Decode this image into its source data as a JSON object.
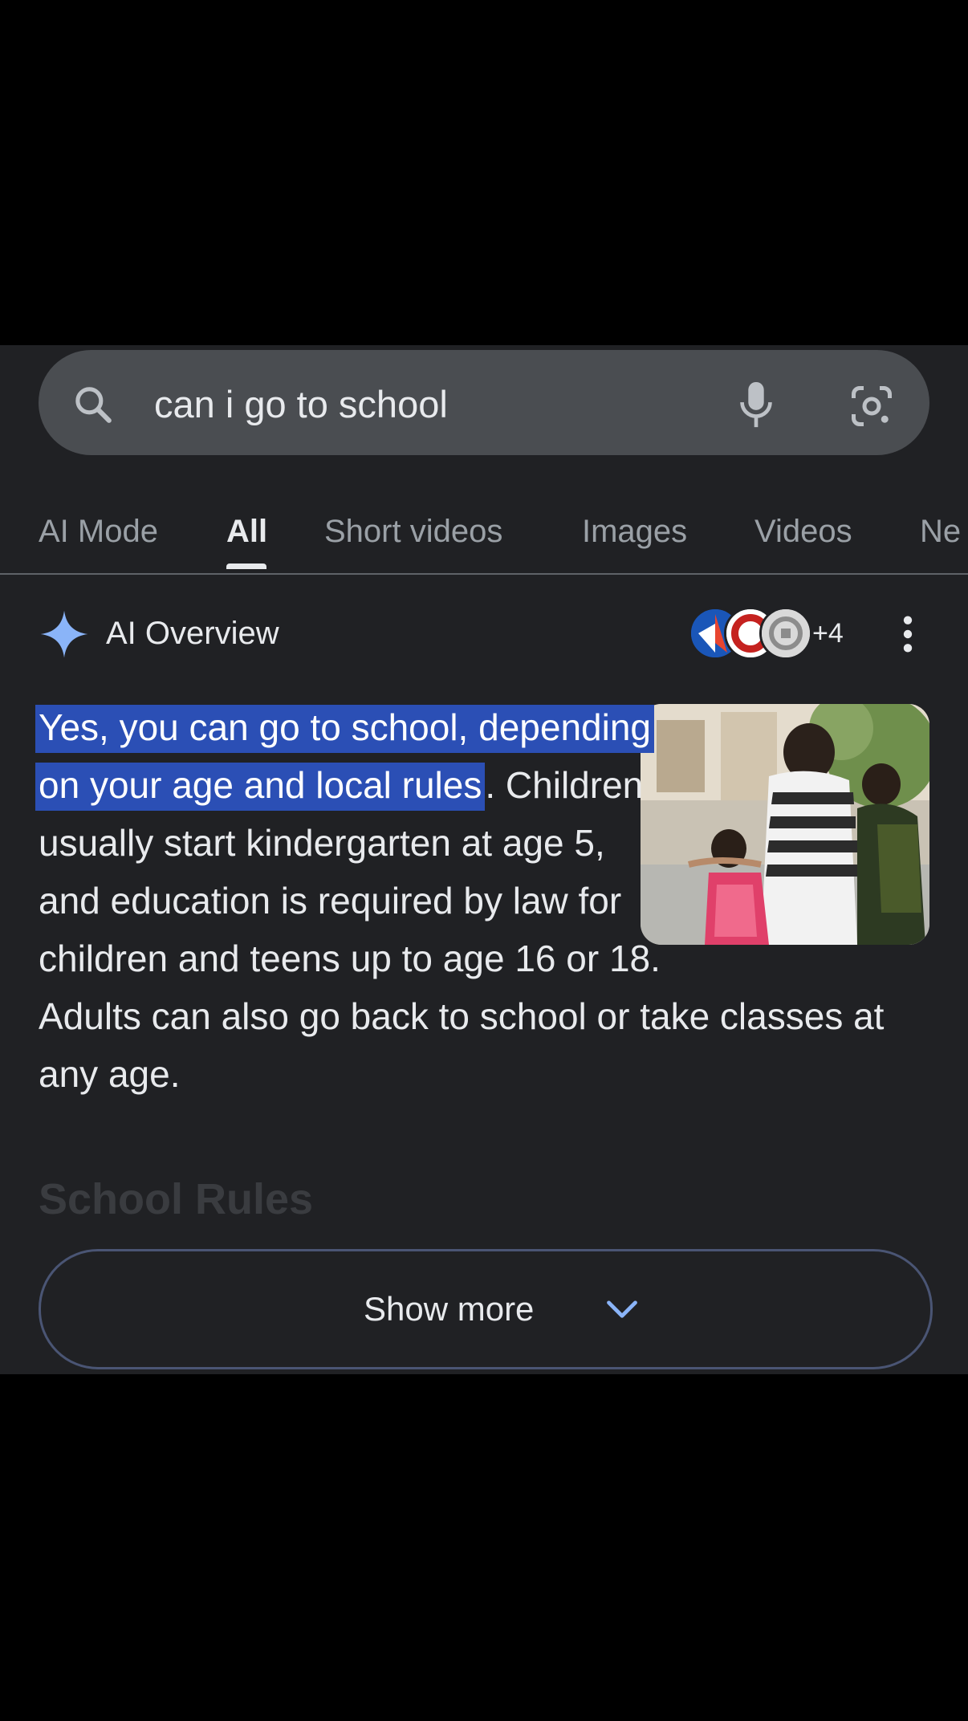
{
  "search": {
    "query": "can i go to school"
  },
  "tabs": [
    {
      "label": "AI Mode"
    },
    {
      "label": "All"
    },
    {
      "label": "Short videos"
    },
    {
      "label": "Images"
    },
    {
      "label": "Videos"
    },
    {
      "label": "Ne"
    }
  ],
  "ai_overview": {
    "title": "AI Overview",
    "source_count": "+4",
    "answer_highlight": "Yes, you can go to school, depending on your age and local rules",
    "answer_rest": ". Children usually start kindergarten at age 5, and education is required by law for children and teens up to age 16 or 18. Adults can also go back to school or take classes at any age.",
    "next_heading": "School Rules",
    "show_more_label": "Show more"
  },
  "colors": {
    "panel_background": "#202124",
    "search_background": "#4a4d51",
    "highlight": "#2b4fb5",
    "gemini_spark": "#8ab4f8",
    "show_more_border": "#4a5574",
    "chevron": "#8ab4f8"
  },
  "icons": {
    "search": "search-icon",
    "mic": "mic-icon",
    "lens": "lens-icon",
    "ai": "gemini-spark-icon",
    "more": "more-vert-icon",
    "expand": "chevron-down-icon"
  }
}
